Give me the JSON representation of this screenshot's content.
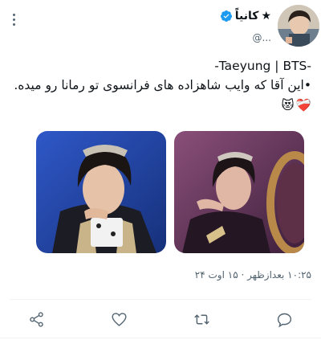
{
  "tweet": {
    "display_name": "کانیاً",
    "display_star": "★",
    "handle": "@...",
    "text_lines": [
      "-Taeyung | BTS-",
      "•این آقا که وایب شاهزاده های فرانسوی تو رمانا رو میده."
    ],
    "emojis": [
      "❤️‍🩹",
      "😻"
    ],
    "timestamp": "۱۰:۲۵ بعدازظهر · ۱۵ اوت ۲۴"
  },
  "icons": {
    "more": "more-vertical-icon",
    "verified": "verified-badge-icon",
    "share": "share-icon",
    "like": "heart-icon",
    "retweet": "retweet-icon",
    "reply": "reply-icon"
  },
  "colors": {
    "verified": "#1d9bf0",
    "secondary_text": "#536471",
    "divider": "#eff3f4"
  }
}
